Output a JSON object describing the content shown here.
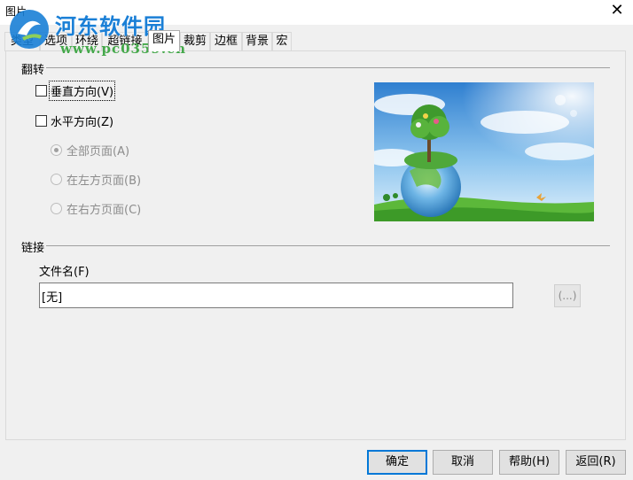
{
  "window": {
    "title": "图片",
    "close_glyph": "✕"
  },
  "watermark": {
    "name": "河东软件园",
    "url": "www.pc0359.cn"
  },
  "tabs": [
    {
      "label": "类型"
    },
    {
      "label": "选项"
    },
    {
      "label": "环绕"
    },
    {
      "label": "超链接"
    },
    {
      "label": "图片"
    },
    {
      "label": "裁剪"
    },
    {
      "label": "边框"
    },
    {
      "label": "背景"
    },
    {
      "label": "宏"
    }
  ],
  "flip": {
    "title": "翻转",
    "vertical": "垂直方向(V)",
    "horizontal": "水平方向(Z)",
    "all_pages": "全部页面(A)",
    "left_pages": "在左方页面(B)",
    "right_pages": "在右方页面(C)"
  },
  "link": {
    "title": "链接",
    "file_label": "文件名(F)",
    "file_value": "[无]",
    "browse_label": "(...)"
  },
  "buttons": {
    "ok": "确定",
    "cancel": "取消",
    "help": "帮助(H)",
    "reset": "返回(R)"
  },
  "icons": {
    "close": "close-icon",
    "preview": "image-preview"
  },
  "colors": {
    "accent": "#0078d7",
    "watermark_blue": "#1a7fd6",
    "watermark_green": "#44a84a"
  }
}
